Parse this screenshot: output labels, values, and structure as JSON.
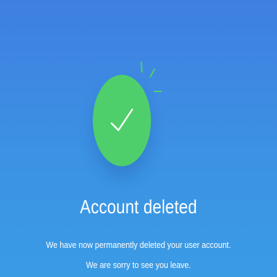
{
  "screen": {
    "title": "Account deleted",
    "message_line_1": "We have now permanently deleted your user account.",
    "message_line_2": "We are sorry to see you leave."
  },
  "icons": {
    "status": "check-icon",
    "accent": "sparkle-icon"
  },
  "colors": {
    "background_top": "#3f7fe0",
    "background_bottom": "#3a9be5",
    "success": "#4fcf6c",
    "text": "#ffffff"
  }
}
